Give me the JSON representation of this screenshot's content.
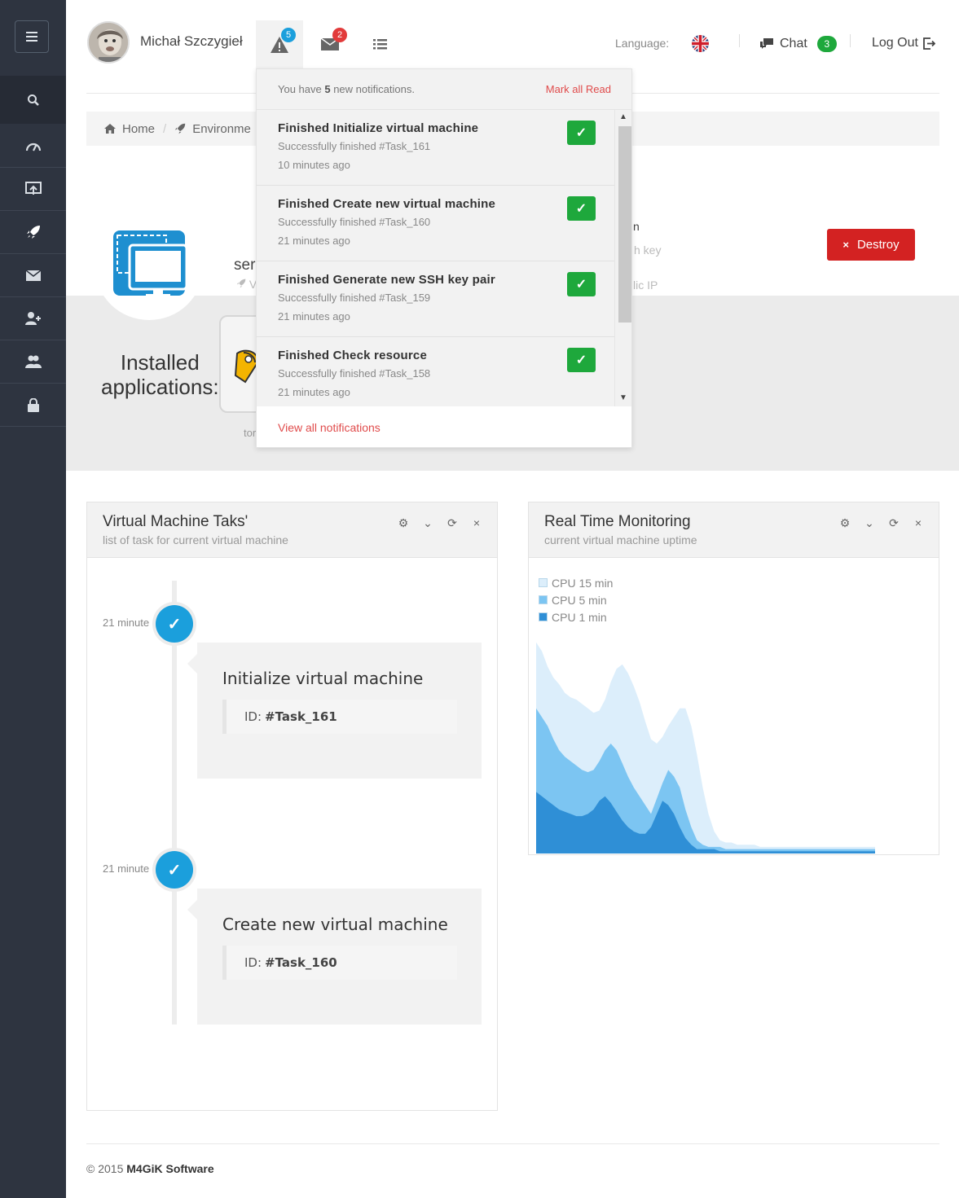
{
  "header": {
    "user_name": "Michał Szczygieł",
    "alerts_count": "5",
    "messages_count": "2",
    "language_label": "Language:",
    "chat_label": "Chat",
    "chat_count": "3",
    "logout_label": "Log Out"
  },
  "breadcrumb": {
    "home": "Home",
    "environment": "Environme"
  },
  "environment": {
    "name": "ser",
    "sub": "V",
    "right_frag_1": "n",
    "right_frag_2": "h key",
    "right_frag_3": "lic IP",
    "destroy_label": "Destroy",
    "installed_line1": "Installed",
    "installed_line2": "applications:",
    "app_label": "tor"
  },
  "notifications": {
    "summary_pre": "You have ",
    "summary_count": "5",
    "summary_post": " new notifications.",
    "mark_all_read": "Mark all Read",
    "items": [
      {
        "title": "Finished Initialize virtual machine",
        "sub": "Successfully finished #Task_161",
        "time": "10 minutes ago"
      },
      {
        "title": "Finished Create new virtual machine",
        "sub": "Successfully finished #Task_160",
        "time": "21 minutes ago"
      },
      {
        "title": "Finished Generate new SSH key pair",
        "sub": "Successfully finished #Task_159",
        "time": "21 minutes ago"
      },
      {
        "title": "Finished Check resource",
        "sub": "Successfully finished #Task_158",
        "time": "21 minutes ago"
      }
    ],
    "view_all": "View all notifications"
  },
  "tasks_panel": {
    "title": "Virtual Machine Taks'",
    "subtitle": "list of task for current virtual machine",
    "items": [
      {
        "time": "21 minute",
        "title": "Initialize virtual machine",
        "id_label": "ID:",
        "id": "#Task_161"
      },
      {
        "time": "21 minute",
        "title": "Create new virtual machine",
        "id_label": "ID:",
        "id": "#Task_160"
      }
    ]
  },
  "monitor_panel": {
    "title": "Real Time Monitoring",
    "subtitle": "current virtual machine uptime"
  },
  "chart_data": {
    "type": "area",
    "series": [
      {
        "name": "CPU 15 min",
        "color": "#dceefb",
        "values": [
          0.96,
          0.92,
          0.85,
          0.8,
          0.77,
          0.73,
          0.71,
          0.7,
          0.68,
          0.66,
          0.64,
          0.65,
          0.7,
          0.78,
          0.84,
          0.86,
          0.82,
          0.76,
          0.69,
          0.6,
          0.52,
          0.5,
          0.53,
          0.58,
          0.62,
          0.66,
          0.66,
          0.58,
          0.45,
          0.3,
          0.18,
          0.1,
          0.06,
          0.05,
          0.05,
          0.04,
          0.04,
          0.04,
          0.04,
          0.03,
          0.03,
          0.03,
          0.03,
          0.03,
          0.03,
          0.03,
          0.03,
          0.03,
          0.03,
          0.03,
          0.03,
          0.03,
          0.03,
          0.03,
          0.03,
          0.03,
          0.03,
          0.03,
          0.03,
          0.03
        ]
      },
      {
        "name": "CPU 5 min",
        "color": "#7cc5f2",
        "values": [
          0.66,
          0.62,
          0.58,
          0.52,
          0.47,
          0.44,
          0.42,
          0.4,
          0.38,
          0.37,
          0.38,
          0.42,
          0.47,
          0.5,
          0.47,
          0.41,
          0.35,
          0.3,
          0.26,
          0.22,
          0.18,
          0.25,
          0.32,
          0.38,
          0.35,
          0.3,
          0.2,
          0.12,
          0.06,
          0.04,
          0.03,
          0.03,
          0.03,
          0.02,
          0.02,
          0.02,
          0.02,
          0.02,
          0.02,
          0.02,
          0.02,
          0.02,
          0.02,
          0.02,
          0.02,
          0.02,
          0.02,
          0.02,
          0.02,
          0.02,
          0.02,
          0.02,
          0.02,
          0.02,
          0.02,
          0.02,
          0.02,
          0.02,
          0.02,
          0.02
        ]
      },
      {
        "name": "CPU 1 min",
        "color": "#2f8fd6",
        "values": [
          0.28,
          0.26,
          0.24,
          0.22,
          0.2,
          0.19,
          0.18,
          0.17,
          0.17,
          0.18,
          0.2,
          0.24,
          0.26,
          0.23,
          0.19,
          0.15,
          0.12,
          0.1,
          0.09,
          0.09,
          0.12,
          0.18,
          0.24,
          0.22,
          0.18,
          0.12,
          0.07,
          0.04,
          0.02,
          0.02,
          0.02,
          0.02,
          0.01,
          0.01,
          0.01,
          0.01,
          0.01,
          0.01,
          0.01,
          0.01,
          0.01,
          0.01,
          0.01,
          0.01,
          0.01,
          0.01,
          0.01,
          0.01,
          0.01,
          0.01,
          0.01,
          0.01,
          0.01,
          0.01,
          0.01,
          0.01,
          0.01,
          0.01,
          0.01,
          0.01
        ]
      }
    ],
    "legend": "top-left",
    "grid": false
  },
  "footer": {
    "copyright": "© 2015",
    "company": "M4GiK Software"
  }
}
